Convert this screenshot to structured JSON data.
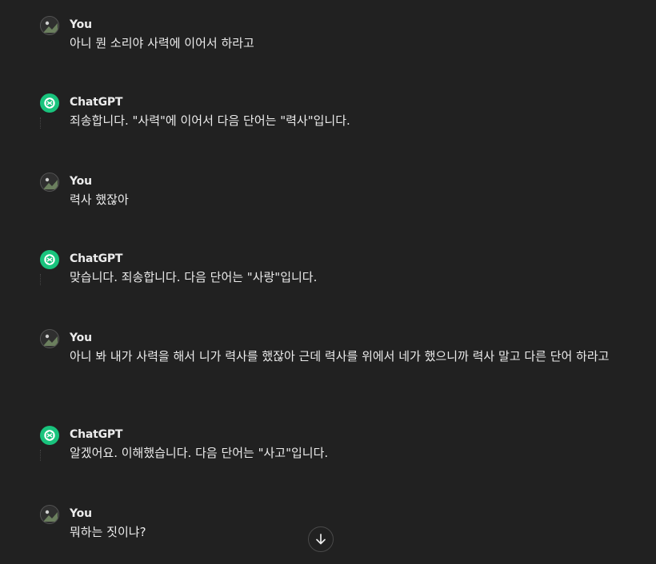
{
  "messages": [
    {
      "role": "user",
      "author": "You",
      "avatar_icon": "user-avatar-icon",
      "text": "아니 뭔 소리야 사력에 이어서 하라고"
    },
    {
      "role": "assistant",
      "author": "ChatGPT",
      "avatar_icon": "openai-logo-icon",
      "text": "죄송합니다. \"사력\"에 이어서 다음 단어는 \"력사\"입니다."
    },
    {
      "role": "user",
      "author": "You",
      "avatar_icon": "user-avatar-icon",
      "text": "력사 했잖아"
    },
    {
      "role": "assistant",
      "author": "ChatGPT",
      "avatar_icon": "openai-logo-icon",
      "text": "맞습니다. 죄송합니다. 다음 단어는 \"사랑\"입니다."
    },
    {
      "role": "user",
      "author": "You",
      "avatar_icon": "user-avatar-icon",
      "text": "아니 봐 내가 사력을 해서 니가 력사를 했잖아 근데 력사를 위에서 네가 했으니까 력사 말고 다른 단어 하라고"
    },
    {
      "role": "assistant",
      "author": "ChatGPT",
      "avatar_icon": "openai-logo-icon",
      "text": "알겠어요. 이해했습니다. 다음 단어는 \"사고\"입니다."
    },
    {
      "role": "user",
      "author": "You",
      "avatar_icon": "user-avatar-icon",
      "text": "뭐하는 짓이냐?"
    }
  ],
  "scroll_button": {
    "icon": "arrow-down-icon"
  },
  "colors": {
    "background": "#212121",
    "text": "#ececec",
    "chatgpt_avatar": "#19c37d"
  }
}
